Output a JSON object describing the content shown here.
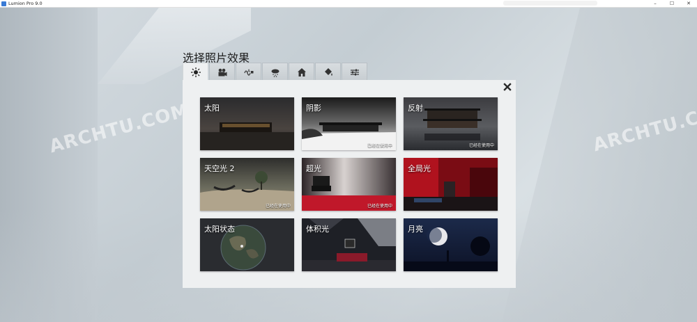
{
  "window": {
    "title": "Lumion Pro 9.0",
    "controls": [
      "–",
      "☐",
      "✕"
    ]
  },
  "watermark_text": "ARCHTU.COM",
  "dialog": {
    "heading": "选择照片效果",
    "tabs": [
      {
        "icon": "sun-icon",
        "active": true
      },
      {
        "icon": "camera-icon",
        "active": false
      },
      {
        "icon": "text-effect-icon",
        "active": false
      },
      {
        "icon": "weather-icon",
        "active": false
      },
      {
        "icon": "house-icon",
        "active": false
      },
      {
        "icon": "paint-bucket-icon",
        "active": false
      },
      {
        "icon": "sliders-icon",
        "active": false
      }
    ],
    "close_icon": "close-icon",
    "effects": [
      {
        "label": "太阳",
        "status": ""
      },
      {
        "label": "阴影",
        "status": "已经在使用中"
      },
      {
        "label": "反射",
        "status": "已经在使用中"
      },
      {
        "label": "天空光 2",
        "status": "已经在使用中"
      },
      {
        "label": "超光",
        "status": "已经在使用中"
      },
      {
        "label": "全局光",
        "status": ""
      },
      {
        "label": "太阳状态",
        "status": ""
      },
      {
        "label": "体积光",
        "status": ""
      },
      {
        "label": "月亮",
        "status": ""
      }
    ]
  },
  "colors": {
    "panel": "#eef0f1",
    "accent_red": "#c0182a"
  }
}
